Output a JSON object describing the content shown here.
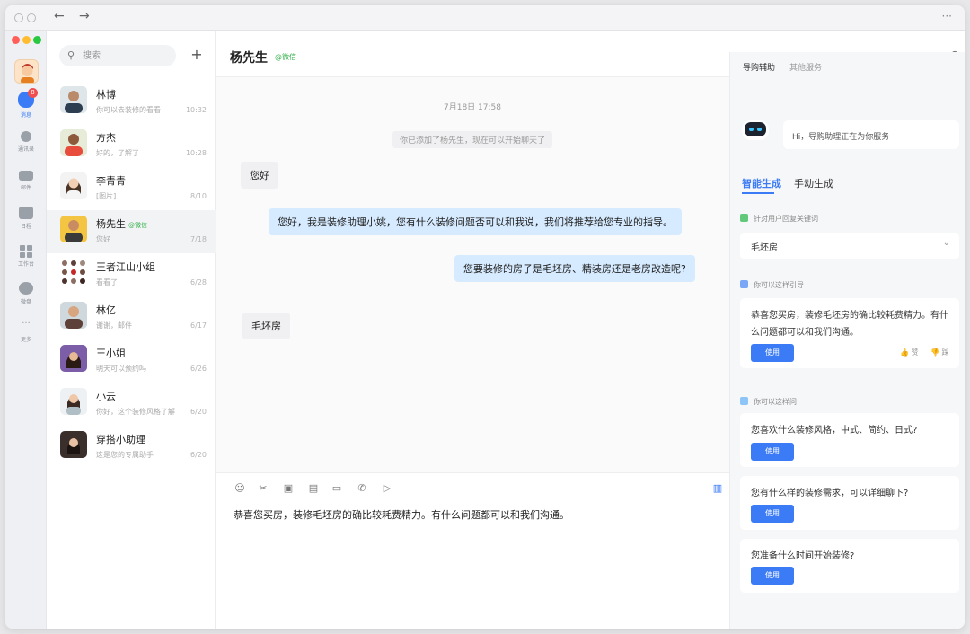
{
  "topbar": {
    "title": "",
    "more": "···",
    "back": "←",
    "forward": "→"
  },
  "rail": {
    "items": [
      {
        "label": "消息",
        "badge": "8",
        "icon": "message-icon"
      },
      {
        "label": "通讯录",
        "icon": "contacts-icon"
      },
      {
        "label": "邮件",
        "icon": "mail-icon"
      },
      {
        "label": "日程",
        "icon": "calendar-icon"
      },
      {
        "label": "工作台",
        "icon": "workbench-icon"
      },
      {
        "label": "微盘",
        "icon": "drive-icon"
      },
      {
        "label": "更多",
        "icon": "more-icon"
      }
    ]
  },
  "contacts": {
    "search_placeholder": "搜索",
    "add": "+",
    "list": [
      {
        "name": "林博",
        "tag": "",
        "preview": "你可以去装修的看看",
        "time": "10:32"
      },
      {
        "name": "方杰",
        "tag": "",
        "preview": "好的，了解了",
        "time": "10:28"
      },
      {
        "name": "李青青",
        "tag": "",
        "preview": "[图片]",
        "time": "8/10"
      },
      {
        "name": "杨先生",
        "tag": "@微信",
        "preview": "您好",
        "time": "7/18"
      },
      {
        "name": "王者江山小组",
        "tag": "",
        "preview": "看看了",
        "time": "6/28"
      },
      {
        "name": "林亿",
        "tag": "",
        "preview": "谢谢，邮件",
        "time": "6/17"
      },
      {
        "name": "王小姐",
        "tag": "",
        "preview": "明天可以预约吗",
        "time": "6/26"
      },
      {
        "name": "小云",
        "tag": "",
        "preview": "你好，这个装修风格了解",
        "time": "6/20"
      },
      {
        "name": "穿搭小助理",
        "tag": "",
        "preview": "这是您的专属助手",
        "time": "6/20"
      }
    ]
  },
  "chat": {
    "title": "杨先生",
    "title_tag": "@微信",
    "date": "7月18日  17:58",
    "system_note": "你已添加了杨先生，现在可以开始聊天了",
    "messages": [
      {
        "side": "left",
        "text": "您好"
      },
      {
        "side": "right",
        "text": "您好，我是装修助理小姚，您有什么装修问题否可以和我说，我们将推荐给您专业的指导。"
      },
      {
        "side": "right",
        "text": "您要装修的房子是毛坯房、精装房还是老房改造呢?"
      },
      {
        "side": "left",
        "text": "毛坯房"
      }
    ],
    "composer_text": "恭喜您买房，装修毛坯房的确比较耗费精力。有什么问题都可以和我们沟通。"
  },
  "assistant": {
    "tabs": [
      "导购辅助",
      "其他服务"
    ],
    "bot_greeting": "Hi，导购助理正在为你服务",
    "sub_tabs": [
      "智能生成",
      "手动生成"
    ],
    "keyword_label": "针对用户回复关键词",
    "keyword_value": "毛坯房",
    "guide_label": "你可以这样引导",
    "guide_text": "恭喜您买房，装修毛坯房的确比较耗费精力。有什么问题都可以和我们沟通。",
    "use_label": "使用",
    "like_label": "赞",
    "dislike_label": "踩",
    "ask_label": "你可以这样问",
    "questions": [
      "您喜欢什么装修风格，中式、简约、日式?",
      "您有什么样的装修需求，可以详细聊下?",
      "您准备什么时间开始装修?"
    ]
  },
  "colors": {
    "accent": "#3b7bf6",
    "wechat_green": "#37b24d",
    "bubble_right": "#d6ebff"
  }
}
